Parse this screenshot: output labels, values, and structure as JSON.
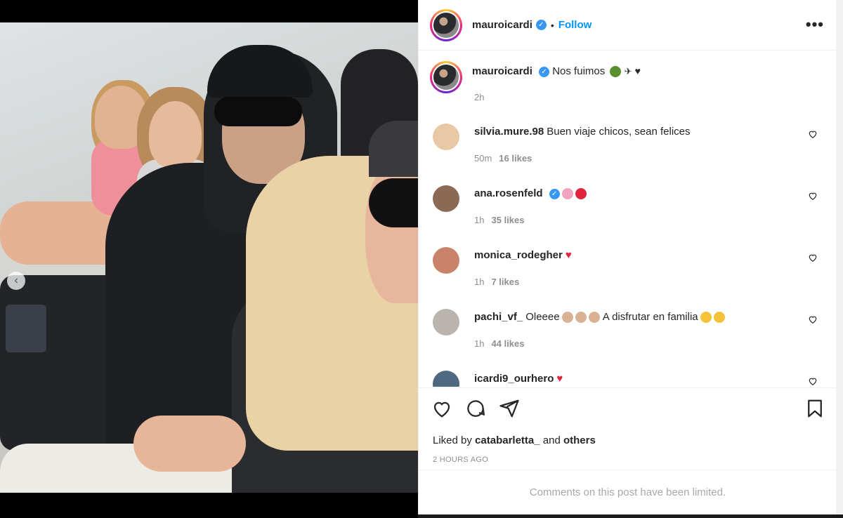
{
  "post": {
    "username": "mauroicardi",
    "follow_label": "Follow",
    "separator": "•",
    "more_label": "•••",
    "caption_text": "Nos fuimos",
    "caption_time": "2h"
  },
  "comments": [
    {
      "name": "silvia.mure.98",
      "text": "Buen viaje chicos, sean felices",
      "time": "50m",
      "likes": "16 likes",
      "avatar_color": "#e9c9a5"
    },
    {
      "name": "ana.rosenfeld",
      "text": "",
      "time": "1h",
      "likes": "35 likes",
      "avatar_color": "#8a6a55",
      "verified": true
    },
    {
      "name": "monica_rodegher",
      "text": "",
      "time": "1h",
      "likes": "7 likes",
      "avatar_color": "#c9836a"
    },
    {
      "name": "pachi_vf_",
      "text": "Oleeee",
      "text2": "A disfrutar en familia",
      "time": "1h",
      "likes": "44 likes",
      "avatar_color": "#b9b4ad"
    },
    {
      "name": "icardi9_ourhero",
      "text": "",
      "time": "",
      "likes": "",
      "avatar_color": "#4f6a80"
    }
  ],
  "footer": {
    "liked_by_prefix": "Liked by",
    "liked_by_user": "catabarletta_",
    "liked_by_and": "and",
    "liked_by_others": "others",
    "time_ago": "2 HOURS AGO",
    "limited_notice": "Comments on this post have been limited."
  },
  "icons": [
    "heart-icon",
    "comment-icon",
    "share-icon",
    "bookmark-icon",
    "more-icon",
    "verified-icon",
    "carousel-prev-icon"
  ],
  "colors": {
    "link": "#0095f6",
    "verified": "#3897f0",
    "heart": "#e0243d",
    "muted": "#8e8e8e"
  }
}
